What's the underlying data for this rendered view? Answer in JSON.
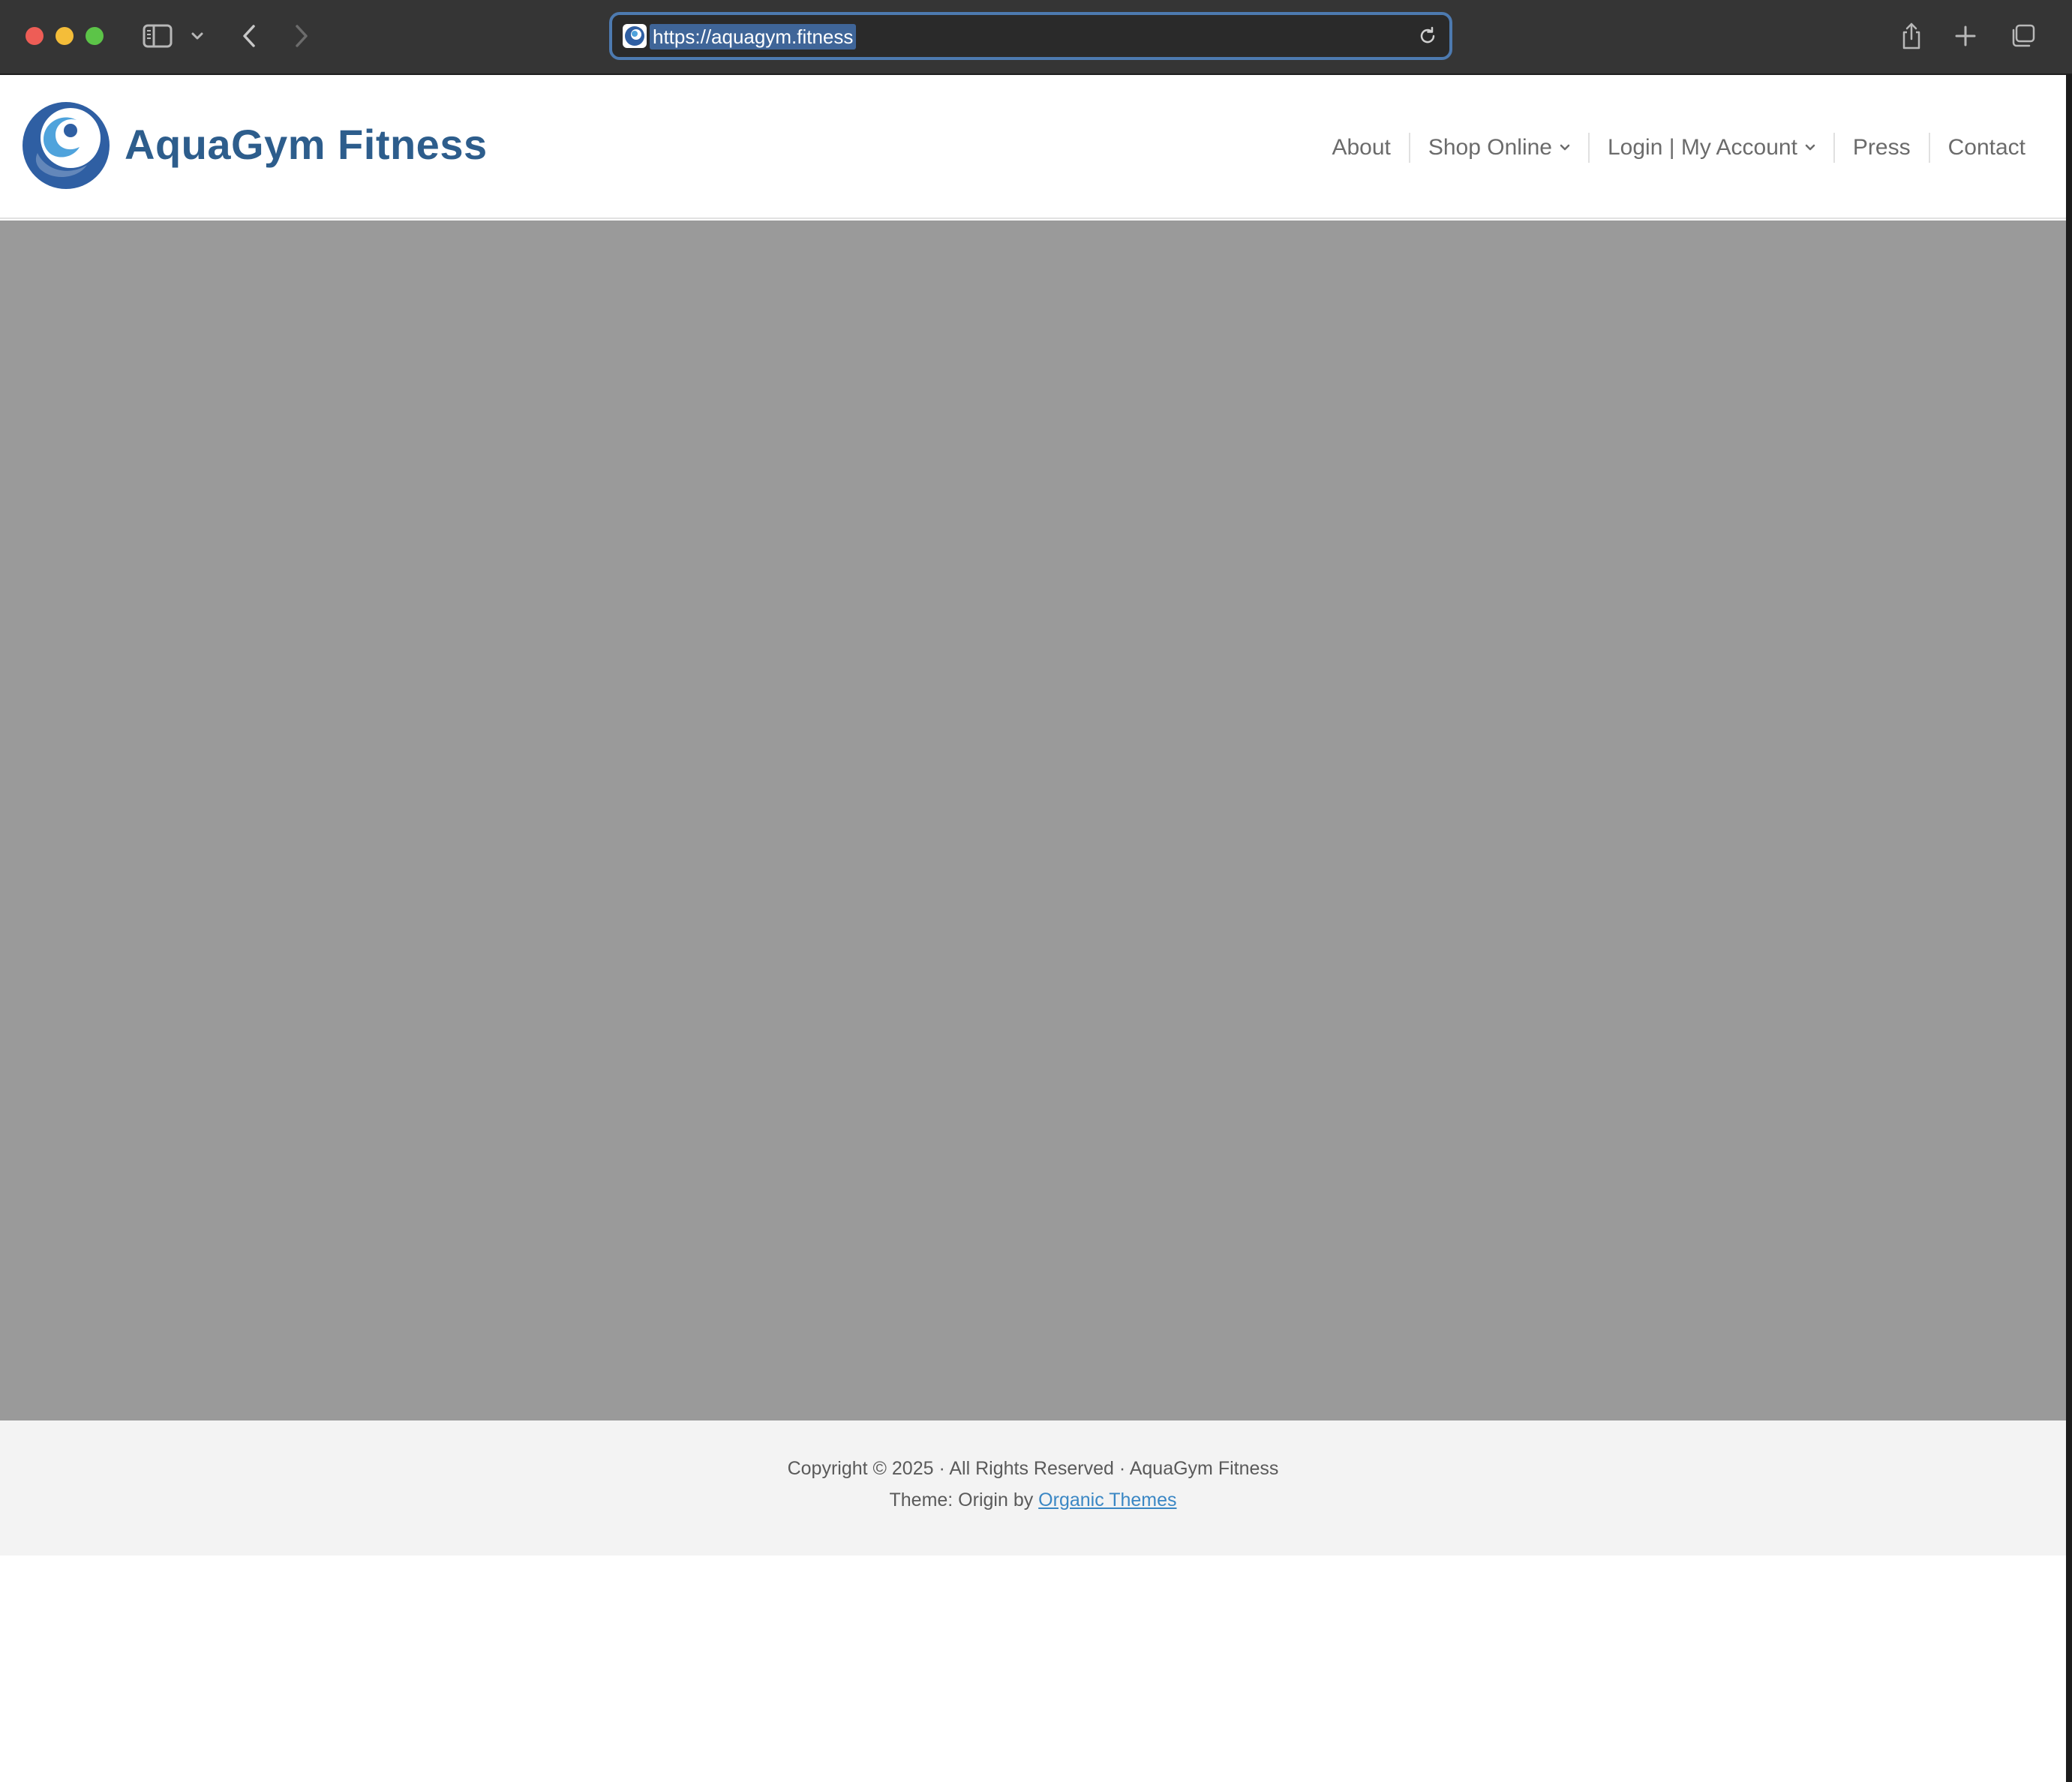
{
  "browser": {
    "url": "https://aquagym.fitness",
    "icons": {
      "close": "close-window-dot",
      "minimize": "minimize-window-dot",
      "zoom": "zoom-window-dot",
      "sidebar": "sidebar-icon",
      "sidebar_menu": "chevron-down-icon",
      "back": "back-arrow-icon",
      "forward": "forward-arrow-icon",
      "reload": "reload-icon",
      "share": "share-icon",
      "new_tab": "plus-icon",
      "tabs": "tab-overview-icon"
    },
    "colors": {
      "chrome_bg": "#353535",
      "url_focus_ring": "#4d7ab0",
      "url_selection": "#3f6598"
    }
  },
  "site": {
    "name": "AquaGym Fitness",
    "brand_color": "#2d5d8c",
    "logo_icon": "wave-logo-icon",
    "nav": {
      "items": [
        {
          "label": "About",
          "has_dropdown": false
        },
        {
          "label": "Shop Online",
          "has_dropdown": true
        },
        {
          "label": "Login | My Account",
          "has_dropdown": true
        },
        {
          "label": "Press",
          "has_dropdown": false
        },
        {
          "label": "Contact",
          "has_dropdown": false
        }
      ]
    },
    "hero": {
      "background": "#9a9a9a"
    },
    "footer": {
      "copyright": "Copyright © 2025 · All Rights Reserved · AquaGym Fitness",
      "theme_prefix": "Theme: Origin by ",
      "theme_link": "Organic Themes",
      "link_color": "#3b87c4"
    }
  }
}
